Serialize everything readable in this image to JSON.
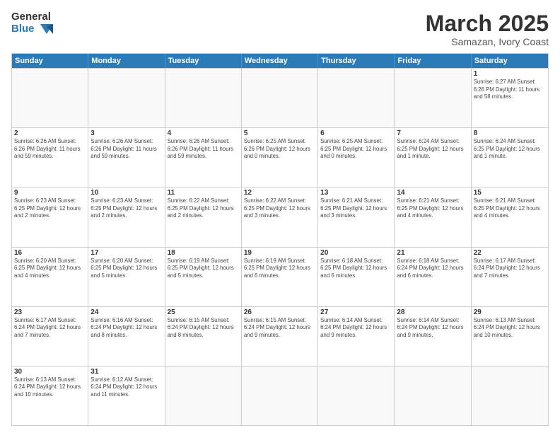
{
  "logo": {
    "text_general": "General",
    "text_blue": "Blue"
  },
  "title": "March 2025",
  "subtitle": "Samazan, Ivory Coast",
  "header_days": [
    "Sunday",
    "Monday",
    "Tuesday",
    "Wednesday",
    "Thursday",
    "Friday",
    "Saturday"
  ],
  "weeks": [
    [
      {
        "day": "",
        "info": ""
      },
      {
        "day": "",
        "info": ""
      },
      {
        "day": "",
        "info": ""
      },
      {
        "day": "",
        "info": ""
      },
      {
        "day": "",
        "info": ""
      },
      {
        "day": "",
        "info": ""
      },
      {
        "day": "1",
        "info": "Sunrise: 6:27 AM\nSunset: 6:26 PM\nDaylight: 11 hours\nand 58 minutes."
      }
    ],
    [
      {
        "day": "2",
        "info": "Sunrise: 6:26 AM\nSunset: 6:26 PM\nDaylight: 11 hours\nand 59 minutes."
      },
      {
        "day": "3",
        "info": "Sunrise: 6:26 AM\nSunset: 6:26 PM\nDaylight: 11 hours\nand 59 minutes."
      },
      {
        "day": "4",
        "info": "Sunrise: 6:26 AM\nSunset: 6:26 PM\nDaylight: 11 hours\nand 59 minutes."
      },
      {
        "day": "5",
        "info": "Sunrise: 6:25 AM\nSunset: 6:26 PM\nDaylight: 12 hours\nand 0 minutes."
      },
      {
        "day": "6",
        "info": "Sunrise: 6:25 AM\nSunset: 6:25 PM\nDaylight: 12 hours\nand 0 minutes."
      },
      {
        "day": "7",
        "info": "Sunrise: 6:24 AM\nSunset: 6:25 PM\nDaylight: 12 hours\nand 1 minute."
      },
      {
        "day": "8",
        "info": "Sunrise: 6:24 AM\nSunset: 6:25 PM\nDaylight: 12 hours\nand 1 minute."
      }
    ],
    [
      {
        "day": "9",
        "info": "Sunrise: 6:23 AM\nSunset: 6:25 PM\nDaylight: 12 hours\nand 2 minutes."
      },
      {
        "day": "10",
        "info": "Sunrise: 6:23 AM\nSunset: 6:25 PM\nDaylight: 12 hours\nand 2 minutes."
      },
      {
        "day": "11",
        "info": "Sunrise: 6:22 AM\nSunset: 6:25 PM\nDaylight: 12 hours\nand 2 minutes."
      },
      {
        "day": "12",
        "info": "Sunrise: 6:22 AM\nSunset: 6:25 PM\nDaylight: 12 hours\nand 3 minutes."
      },
      {
        "day": "13",
        "info": "Sunrise: 6:21 AM\nSunset: 6:25 PM\nDaylight: 12 hours\nand 3 minutes."
      },
      {
        "day": "14",
        "info": "Sunrise: 6:21 AM\nSunset: 6:25 PM\nDaylight: 12 hours\nand 4 minutes."
      },
      {
        "day": "15",
        "info": "Sunrise: 6:21 AM\nSunset: 6:25 PM\nDaylight: 12 hours\nand 4 minutes."
      }
    ],
    [
      {
        "day": "16",
        "info": "Sunrise: 6:20 AM\nSunset: 6:25 PM\nDaylight: 12 hours\nand 4 minutes."
      },
      {
        "day": "17",
        "info": "Sunrise: 6:20 AM\nSunset: 6:25 PM\nDaylight: 12 hours\nand 5 minutes."
      },
      {
        "day": "18",
        "info": "Sunrise: 6:19 AM\nSunset: 6:25 PM\nDaylight: 12 hours\nand 5 minutes."
      },
      {
        "day": "19",
        "info": "Sunrise: 6:19 AM\nSunset: 6:25 PM\nDaylight: 12 hours\nand 6 minutes."
      },
      {
        "day": "20",
        "info": "Sunrise: 6:18 AM\nSunset: 6:25 PM\nDaylight: 12 hours\nand 6 minutes."
      },
      {
        "day": "21",
        "info": "Sunrise: 6:18 AM\nSunset: 6:24 PM\nDaylight: 12 hours\nand 6 minutes."
      },
      {
        "day": "22",
        "info": "Sunrise: 6:17 AM\nSunset: 6:24 PM\nDaylight: 12 hours\nand 7 minutes."
      }
    ],
    [
      {
        "day": "23",
        "info": "Sunrise: 6:17 AM\nSunset: 6:24 PM\nDaylight: 12 hours\nand 7 minutes."
      },
      {
        "day": "24",
        "info": "Sunrise: 6:16 AM\nSunset: 6:24 PM\nDaylight: 12 hours\nand 8 minutes."
      },
      {
        "day": "25",
        "info": "Sunrise: 6:15 AM\nSunset: 6:24 PM\nDaylight: 12 hours\nand 8 minutes."
      },
      {
        "day": "26",
        "info": "Sunrise: 6:15 AM\nSunset: 6:24 PM\nDaylight: 12 hours\nand 9 minutes."
      },
      {
        "day": "27",
        "info": "Sunrise: 6:14 AM\nSunset: 6:24 PM\nDaylight: 12 hours\nand 9 minutes."
      },
      {
        "day": "28",
        "info": "Sunrise: 6:14 AM\nSunset: 6:24 PM\nDaylight: 12 hours\nand 9 minutes."
      },
      {
        "day": "29",
        "info": "Sunrise: 6:13 AM\nSunset: 6:24 PM\nDaylight: 12 hours\nand 10 minutes."
      }
    ],
    [
      {
        "day": "30",
        "info": "Sunrise: 6:13 AM\nSunset: 6:24 PM\nDaylight: 12 hours\nand 10 minutes."
      },
      {
        "day": "31",
        "info": "Sunrise: 6:12 AM\nSunset: 6:24 PM\nDaylight: 12 hours\nand 11 minutes."
      },
      {
        "day": "",
        "info": ""
      },
      {
        "day": "",
        "info": ""
      },
      {
        "day": "",
        "info": ""
      },
      {
        "day": "",
        "info": ""
      },
      {
        "day": "",
        "info": ""
      }
    ]
  ]
}
